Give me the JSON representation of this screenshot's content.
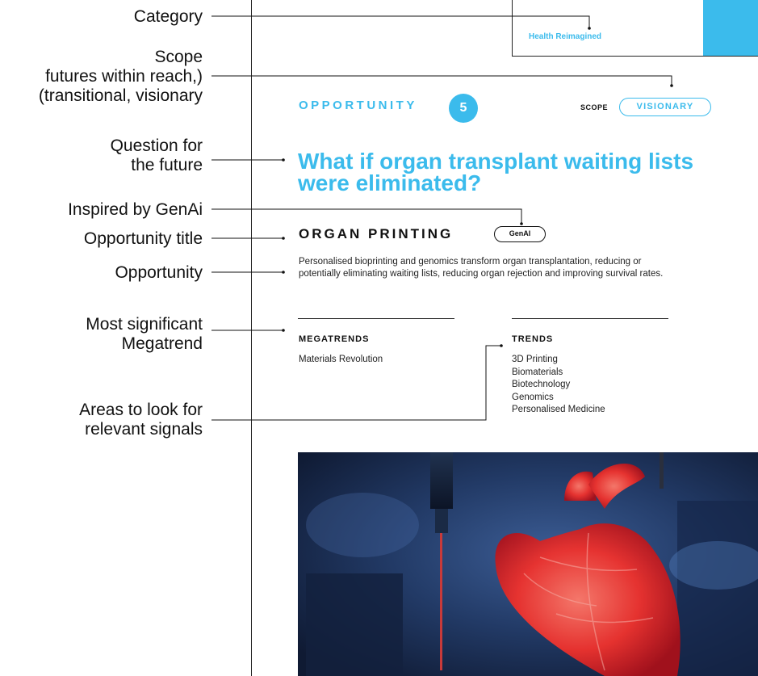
{
  "annotations": {
    "category": [
      "Category"
    ],
    "scope": [
      "Scope",
      "futures within reach,)",
      "(transitional, visionary"
    ],
    "question": [
      "Question for",
      "the future"
    ],
    "genai": [
      "Inspired by GenAi"
    ],
    "opportunity_title": [
      "Opportunity title"
    ],
    "opportunity": [
      "Opportunity"
    ],
    "megatrend": [
      "Most significant",
      "Megatrend"
    ],
    "signals": [
      "Areas to look for",
      "relevant signals"
    ]
  },
  "card": {
    "category": "Health Reimagined",
    "opportunity_label": "OPPORTUNITY",
    "opportunity_number": "5",
    "scope_label": "SCOPE",
    "scope_value": "VISIONARY",
    "question": "What if organ transplant waiting lists were eliminated?",
    "title": "ORGAN PRINTING",
    "genai_badge": "GenAI",
    "description": "Personalised bioprinting and genomics transform organ transplantation, reducing or potentially eliminating waiting lists, reducing organ rejection and improving survival rates.",
    "megatrends_heading": "MEGATRENDS",
    "megatrends": [
      "Materials Revolution"
    ],
    "trends_heading": "TRENDS",
    "trends": [
      "3D Printing",
      "Biomaterials",
      "Biotechnology",
      "Genomics",
      "Personalised Medicine"
    ]
  },
  "colors": {
    "accent": "#3bbbec",
    "text": "#111111",
    "heart": "#ff3b3b",
    "photo_bg": "#1c2d4f"
  },
  "image": {
    "subject": "3D-printed red heart under a bioprinter nozzle"
  }
}
